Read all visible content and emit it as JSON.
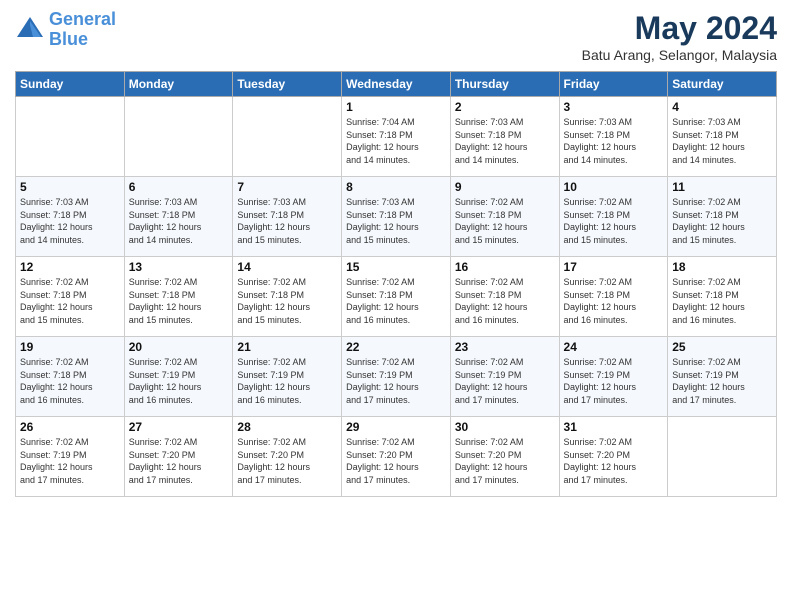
{
  "header": {
    "logo_line1": "General",
    "logo_line2": "Blue",
    "title": "May 2024",
    "subtitle": "Batu Arang, Selangor, Malaysia"
  },
  "days_of_week": [
    "Sunday",
    "Monday",
    "Tuesday",
    "Wednesday",
    "Thursday",
    "Friday",
    "Saturday"
  ],
  "weeks": [
    [
      {
        "day": "",
        "info": ""
      },
      {
        "day": "",
        "info": ""
      },
      {
        "day": "",
        "info": ""
      },
      {
        "day": "1",
        "info": "Sunrise: 7:04 AM\nSunset: 7:18 PM\nDaylight: 12 hours\nand 14 minutes."
      },
      {
        "day": "2",
        "info": "Sunrise: 7:03 AM\nSunset: 7:18 PM\nDaylight: 12 hours\nand 14 minutes."
      },
      {
        "day": "3",
        "info": "Sunrise: 7:03 AM\nSunset: 7:18 PM\nDaylight: 12 hours\nand 14 minutes."
      },
      {
        "day": "4",
        "info": "Sunrise: 7:03 AM\nSunset: 7:18 PM\nDaylight: 12 hours\nand 14 minutes."
      }
    ],
    [
      {
        "day": "5",
        "info": "Sunrise: 7:03 AM\nSunset: 7:18 PM\nDaylight: 12 hours\nand 14 minutes."
      },
      {
        "day": "6",
        "info": "Sunrise: 7:03 AM\nSunset: 7:18 PM\nDaylight: 12 hours\nand 14 minutes."
      },
      {
        "day": "7",
        "info": "Sunrise: 7:03 AM\nSunset: 7:18 PM\nDaylight: 12 hours\nand 15 minutes."
      },
      {
        "day": "8",
        "info": "Sunrise: 7:03 AM\nSunset: 7:18 PM\nDaylight: 12 hours\nand 15 minutes."
      },
      {
        "day": "9",
        "info": "Sunrise: 7:02 AM\nSunset: 7:18 PM\nDaylight: 12 hours\nand 15 minutes."
      },
      {
        "day": "10",
        "info": "Sunrise: 7:02 AM\nSunset: 7:18 PM\nDaylight: 12 hours\nand 15 minutes."
      },
      {
        "day": "11",
        "info": "Sunrise: 7:02 AM\nSunset: 7:18 PM\nDaylight: 12 hours\nand 15 minutes."
      }
    ],
    [
      {
        "day": "12",
        "info": "Sunrise: 7:02 AM\nSunset: 7:18 PM\nDaylight: 12 hours\nand 15 minutes."
      },
      {
        "day": "13",
        "info": "Sunrise: 7:02 AM\nSunset: 7:18 PM\nDaylight: 12 hours\nand 15 minutes."
      },
      {
        "day": "14",
        "info": "Sunrise: 7:02 AM\nSunset: 7:18 PM\nDaylight: 12 hours\nand 15 minutes."
      },
      {
        "day": "15",
        "info": "Sunrise: 7:02 AM\nSunset: 7:18 PM\nDaylight: 12 hours\nand 16 minutes."
      },
      {
        "day": "16",
        "info": "Sunrise: 7:02 AM\nSunset: 7:18 PM\nDaylight: 12 hours\nand 16 minutes."
      },
      {
        "day": "17",
        "info": "Sunrise: 7:02 AM\nSunset: 7:18 PM\nDaylight: 12 hours\nand 16 minutes."
      },
      {
        "day": "18",
        "info": "Sunrise: 7:02 AM\nSunset: 7:18 PM\nDaylight: 12 hours\nand 16 minutes."
      }
    ],
    [
      {
        "day": "19",
        "info": "Sunrise: 7:02 AM\nSunset: 7:18 PM\nDaylight: 12 hours\nand 16 minutes."
      },
      {
        "day": "20",
        "info": "Sunrise: 7:02 AM\nSunset: 7:19 PM\nDaylight: 12 hours\nand 16 minutes."
      },
      {
        "day": "21",
        "info": "Sunrise: 7:02 AM\nSunset: 7:19 PM\nDaylight: 12 hours\nand 16 minutes."
      },
      {
        "day": "22",
        "info": "Sunrise: 7:02 AM\nSunset: 7:19 PM\nDaylight: 12 hours\nand 17 minutes."
      },
      {
        "day": "23",
        "info": "Sunrise: 7:02 AM\nSunset: 7:19 PM\nDaylight: 12 hours\nand 17 minutes."
      },
      {
        "day": "24",
        "info": "Sunrise: 7:02 AM\nSunset: 7:19 PM\nDaylight: 12 hours\nand 17 minutes."
      },
      {
        "day": "25",
        "info": "Sunrise: 7:02 AM\nSunset: 7:19 PM\nDaylight: 12 hours\nand 17 minutes."
      }
    ],
    [
      {
        "day": "26",
        "info": "Sunrise: 7:02 AM\nSunset: 7:19 PM\nDaylight: 12 hours\nand 17 minutes."
      },
      {
        "day": "27",
        "info": "Sunrise: 7:02 AM\nSunset: 7:20 PM\nDaylight: 12 hours\nand 17 minutes."
      },
      {
        "day": "28",
        "info": "Sunrise: 7:02 AM\nSunset: 7:20 PM\nDaylight: 12 hours\nand 17 minutes."
      },
      {
        "day": "29",
        "info": "Sunrise: 7:02 AM\nSunset: 7:20 PM\nDaylight: 12 hours\nand 17 minutes."
      },
      {
        "day": "30",
        "info": "Sunrise: 7:02 AM\nSunset: 7:20 PM\nDaylight: 12 hours\nand 17 minutes."
      },
      {
        "day": "31",
        "info": "Sunrise: 7:02 AM\nSunset: 7:20 PM\nDaylight: 12 hours\nand 17 minutes."
      },
      {
        "day": "",
        "info": ""
      }
    ]
  ]
}
